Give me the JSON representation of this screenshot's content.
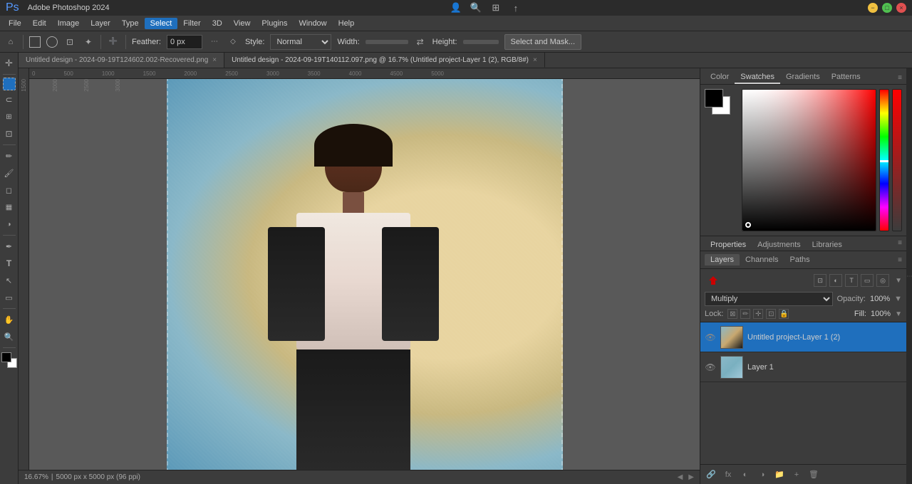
{
  "app": {
    "title": "Adobe Photoshop 2024",
    "window_controls": [
      "minimize",
      "maximize",
      "close"
    ]
  },
  "menu": {
    "items": [
      "File",
      "Edit",
      "Image",
      "Layer",
      "Type",
      "Select",
      "Filter",
      "3D",
      "View",
      "Plugins",
      "Window",
      "Help"
    ]
  },
  "options_bar": {
    "feather_label": "Feather:",
    "feather_value": "0 px",
    "style_label": "Style:",
    "style_value": "Normal",
    "width_label": "Width:",
    "height_label": "Height:",
    "mask_button": "Select and Mask..."
  },
  "tabs": {
    "inactive": "Untitled design - 2024-09-19T124602.002-Recovered.png",
    "active": "Untitled design - 2024-09-19T140112.097.png @ 16.7% (Untitled project-Layer 1 (2), RGB/8#)"
  },
  "color_panel": {
    "tabs": [
      "Color",
      "Swatches",
      "Gradients",
      "Patterns"
    ],
    "active_tab": "Swatches"
  },
  "properties_panel": {
    "tabs": [
      "Properties",
      "Adjustments",
      "Libraries"
    ],
    "active_tab": "Properties"
  },
  "layers_panel": {
    "tabs": [
      "Layers",
      "Channels",
      "Paths"
    ],
    "active_tab": "Layers",
    "blend_mode": "Multiply",
    "opacity_label": "Opacity:",
    "opacity_value": "100%",
    "lock_label": "Lock:",
    "fill_label": "Fill:",
    "fill_value": "100%",
    "layers": [
      {
        "id": 1,
        "name": "Untitled project-Layer 1 (2)",
        "visible": true,
        "active": true
      },
      {
        "id": 2,
        "name": "Layer 1",
        "visible": true,
        "active": false
      }
    ]
  },
  "status": {
    "zoom": "16.67%",
    "dimensions": "5000 px x 5000 px (96 ppi)"
  },
  "tools": {
    "items": [
      "move",
      "marquee",
      "lasso",
      "crop",
      "eyedropper",
      "brush",
      "eraser",
      "gradient",
      "pen",
      "text",
      "select",
      "zoom"
    ]
  }
}
